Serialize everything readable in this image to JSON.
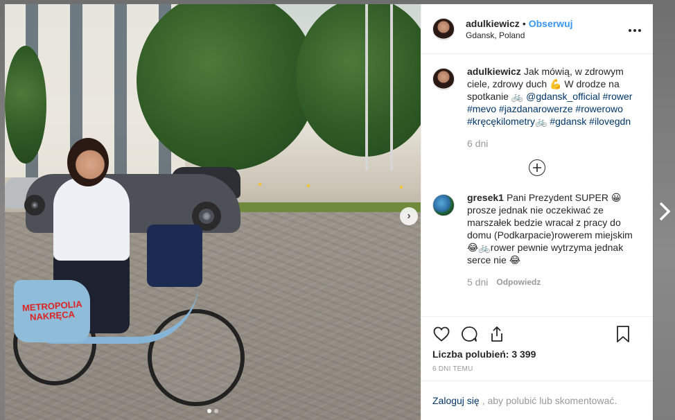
{
  "post": {
    "username": "adulkiewicz",
    "separator": "•",
    "follow_label": "Obserwuj",
    "location": "Gdansk, Poland",
    "more_icon": "more-options-icon"
  },
  "photo": {
    "panel_text_1": "METROPOLIA",
    "panel_text_2": "NAKRĘCA",
    "next_icon": "chevron-right-icon",
    "carousel_dots": 2,
    "active_dot": 0
  },
  "caption": {
    "username": "adulkiewicz",
    "text_part1": "Jak mówią, w zdrowym ciele, zdrowy duch 💪 W drodze na spotkanie 🚲 ",
    "mention": "@gdansk_official",
    "hashtags": "#rower #mevo #jazdanarowerze #rowerowo #kręcękilometry🚲 #gdansk #ilovegdn",
    "time": "6 dni"
  },
  "load_more_icon": "plus-circle-icon",
  "comments": [
    {
      "username": "gresek1",
      "text": "Pani Prezydent SUPER 😀 prosze jednak nie oczekiwać ze marszałek bedzie wracał z pracy do domu (Podkarpacie)rowerem miejskim😂🚲rower pewnie wytrzyma jednak serce nie 😂",
      "time": "5 dni",
      "reply_label": "Odpowiedz"
    }
  ],
  "actions": {
    "like_icon": "heart-icon",
    "comment_icon": "comment-icon",
    "share_icon": "share-icon",
    "save_icon": "bookmark-icon",
    "likes_text": "Liczba polubień: 3 399",
    "time_ago": "6 DNI TEMU"
  },
  "login": {
    "link": "Zaloguj się",
    "rest": ", aby polubić lub skomentować."
  },
  "next_post_icon": "chevron-right-icon",
  "colors": {
    "link": "#003569",
    "follow": "#3897f0",
    "muted": "#999999"
  }
}
